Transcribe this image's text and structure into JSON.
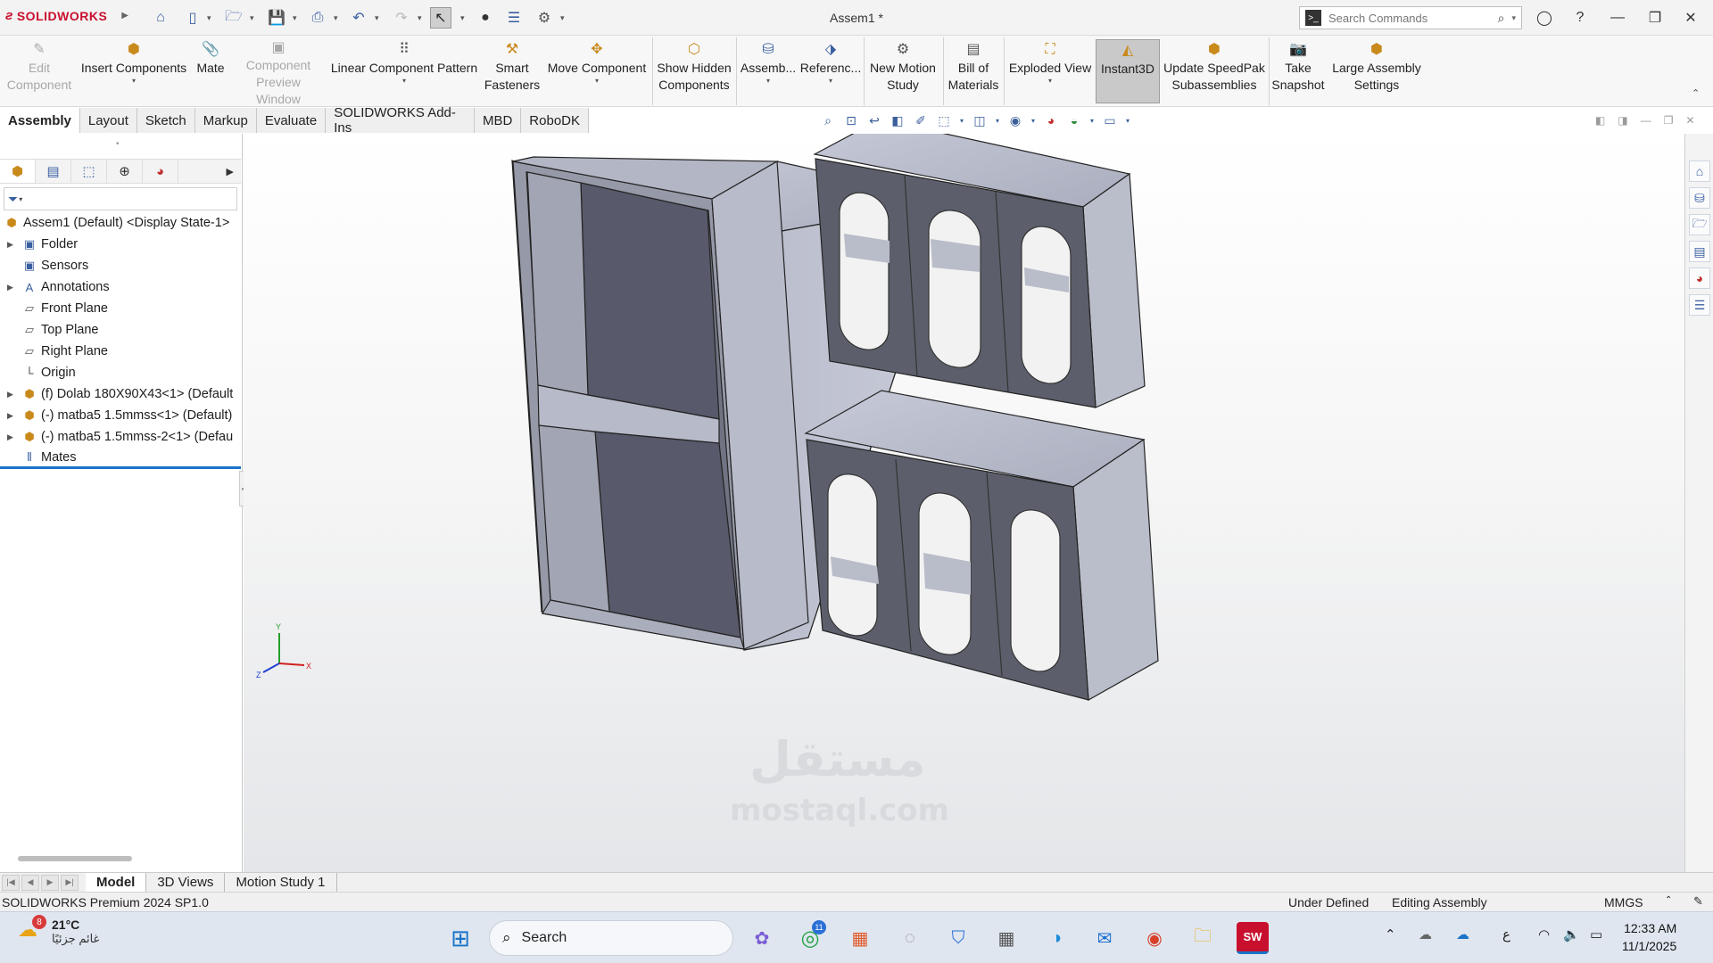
{
  "app": {
    "brand": "SOLIDWORKS",
    "document_title": "Assem1 *",
    "search_placeholder": "Search Commands"
  },
  "command_manager": [
    {
      "label": "Edit\nComponent",
      "l1": "Edit",
      "l2": "Component",
      "disabled": true,
      "icon": "edit-component-icon"
    },
    {
      "l1": "Insert Components",
      "l2": "",
      "icon": "insert-components-icon"
    },
    {
      "l1": "Mate",
      "l2": "",
      "icon": "mate-icon"
    },
    {
      "l1": "Component",
      "l2": "Preview Window",
      "disabled": true,
      "icon": "preview-window-icon"
    },
    {
      "l1": "Linear Component Pattern",
      "l2": "",
      "icon": "pattern-icon"
    },
    {
      "l1": "Smart",
      "l2": "Fasteners",
      "icon": "fasteners-icon"
    },
    {
      "l1": "Move Component",
      "l2": "",
      "icon": "move-component-icon"
    },
    {
      "l1": "Show Hidden",
      "l2": "Components",
      "icon": "show-hidden-icon"
    },
    {
      "l1": "Assemb...",
      "l2": "",
      "icon": "assembly-features-icon"
    },
    {
      "l1": "Referenc...",
      "l2": "",
      "icon": "reference-geometry-icon"
    },
    {
      "l1": "New Motion",
      "l2": "Study",
      "icon": "motion-study-icon"
    },
    {
      "l1": "Bill of",
      "l2": "Materials",
      "icon": "bom-icon"
    },
    {
      "l1": "Exploded View",
      "l2": "",
      "icon": "exploded-view-icon"
    },
    {
      "l1": "Instant3D",
      "l2": "",
      "active": true,
      "icon": "instant3d-icon"
    },
    {
      "l1": "Update SpeedPak",
      "l2": "Subassemblies",
      "icon": "speedpak-icon"
    },
    {
      "l1": "Take",
      "l2": "Snapshot",
      "icon": "snapshot-icon"
    },
    {
      "l1": "Large Assembly",
      "l2": "Settings",
      "icon": "large-assembly-icon"
    }
  ],
  "command_tabs": [
    "Assembly",
    "Layout",
    "Sketch",
    "Markup",
    "Evaluate",
    "SOLIDWORKS Add-Ins",
    "MBD",
    "RoboDK"
  ],
  "feature_tree": [
    {
      "label": "Assem1 (Default) <Display State-1>",
      "icon": "assembly-icon",
      "expander": false,
      "root": true
    },
    {
      "label": "Folder",
      "icon": "folder-icon",
      "expander": true
    },
    {
      "label": "Sensors",
      "icon": "sensors-icon",
      "expander": false
    },
    {
      "label": "Annotations",
      "icon": "annotations-icon",
      "expander": true
    },
    {
      "label": "Front Plane",
      "icon": "plane-icon",
      "expander": false
    },
    {
      "label": "Top Plane",
      "icon": "plane-icon",
      "expander": false
    },
    {
      "label": "Right Plane",
      "icon": "plane-icon",
      "expander": false
    },
    {
      "label": "Origin",
      "icon": "origin-icon",
      "expander": false
    },
    {
      "label": "(f) Dolab 180X90X43<1> (Default",
      "icon": "part-icon",
      "expander": true
    },
    {
      "label": "(-) matba5 1.5mmss<1> (Default)",
      "icon": "part-icon",
      "expander": true
    },
    {
      "label": "(-) matba5 1.5mmss-2<1> (Defau",
      "icon": "part-icon",
      "expander": true
    },
    {
      "label": "Mates",
      "icon": "mates-icon",
      "expander": false
    }
  ],
  "bottom_tabs": [
    "Model",
    "3D Views",
    "Motion Study 1"
  ],
  "status": {
    "product": "SOLIDWORKS Premium 2024 SP1.0",
    "definition": "Under Defined",
    "mode": "Editing Assembly",
    "units": "MMGS"
  },
  "triad": {
    "x": "X",
    "y": "Y",
    "z": "Z"
  },
  "watermark": "mostaql.com",
  "taskbar": {
    "temperature": "21°C",
    "weather_text": "غائم جزئيًا",
    "weather_badge": "8",
    "search_label": "Search",
    "whatsapp_badge": "11",
    "time": "12:33 AM",
    "date": "11/1/2025",
    "lang": "ع"
  },
  "colors": {
    "accent": "#c8102e",
    "model_light": "#b8bccb",
    "model_dark": "#54575f",
    "selection_blue": "#1a73c8"
  }
}
